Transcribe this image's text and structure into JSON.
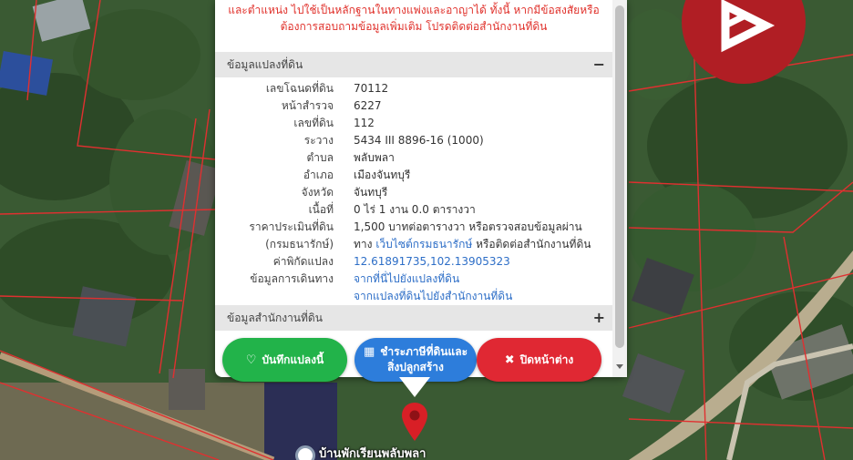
{
  "popup": {
    "notice_line1": "และตำแหน่ง ไปใช้เป็นหลักฐานในทางแพ่งและอาญาได้ ทั้งนี้ หากมีข้อสงสัยหรือ",
    "notice_line2": "ต้องการสอบถามข้อมูลเพิ่มเติม โปรดติดต่อสำนักงานที่ดิน",
    "land_section": {
      "title": "ข้อมูลแปลงที่ดิน",
      "toggle": "−"
    },
    "rows": [
      {
        "label": "เลขโฉนดที่ดิน",
        "value": "70112"
      },
      {
        "label": "หน้าสำรวจ",
        "value": "6227"
      },
      {
        "label": "เลขที่ดิน",
        "value": "112"
      },
      {
        "label": "ระวาง",
        "value": "5434 III 8896-16 (1000)"
      },
      {
        "label": "ตำบล",
        "value": "พลับพลา"
      },
      {
        "label": "อำเภอ",
        "value": "เมืองจันทบุรี"
      },
      {
        "label": "จังหวัด",
        "value": "จันทบุรี"
      },
      {
        "label": "เนื้อที่",
        "value": "0 ไร่ 1 งาน 0.0 ตารางวา"
      },
      {
        "label": "ราคาประเมินที่ดิน",
        "value": "1,500 บาทต่อตารางวา หรือตรวจสอบข้อมูลผ่าน"
      },
      {
        "label": "(กรมธนารักษ์)",
        "value_pre": "ทาง ",
        "value_link": "เว็บไซต์กรมธนารักษ์",
        "value_post": " หรือติดต่อสำนักงานที่ดิน"
      },
      {
        "label": "ค่าพิกัดแปลง",
        "value": "12.61891735,102.13905323"
      },
      {
        "label": "ข้อมูลการเดินทาง",
        "value": "จากที่นี่ไปยังแปลงที่ดิน"
      },
      {
        "label": "",
        "value": "จากแปลงที่ดินไปยังสำนักงานที่ดิน"
      }
    ],
    "office_section": {
      "title": "ข้อมูลสำนักงานที่ดิน",
      "toggle": "+"
    }
  },
  "buttons": {
    "save": {
      "label": "บันทึกแปลงนี้",
      "icon": "heart-icon"
    },
    "tax_line1": "ชำระภาษีที่ดินและ",
    "tax_line2": "สิ่งปลูกสร้าง",
    "tax_icon": "building-icon",
    "close": {
      "label": "ปิดหน้าต่าง",
      "icon": "close-icon"
    }
  },
  "map": {
    "label": "บ้านพักเรียนพลับพลา"
  },
  "colors": {
    "notice": "#e0312b",
    "link": "#2d6ec7",
    "save": "#22b34a",
    "tax": "#2d7ddb",
    "close": "#e02833",
    "brand": "#b01e24",
    "parcel_line": "#e03030"
  }
}
